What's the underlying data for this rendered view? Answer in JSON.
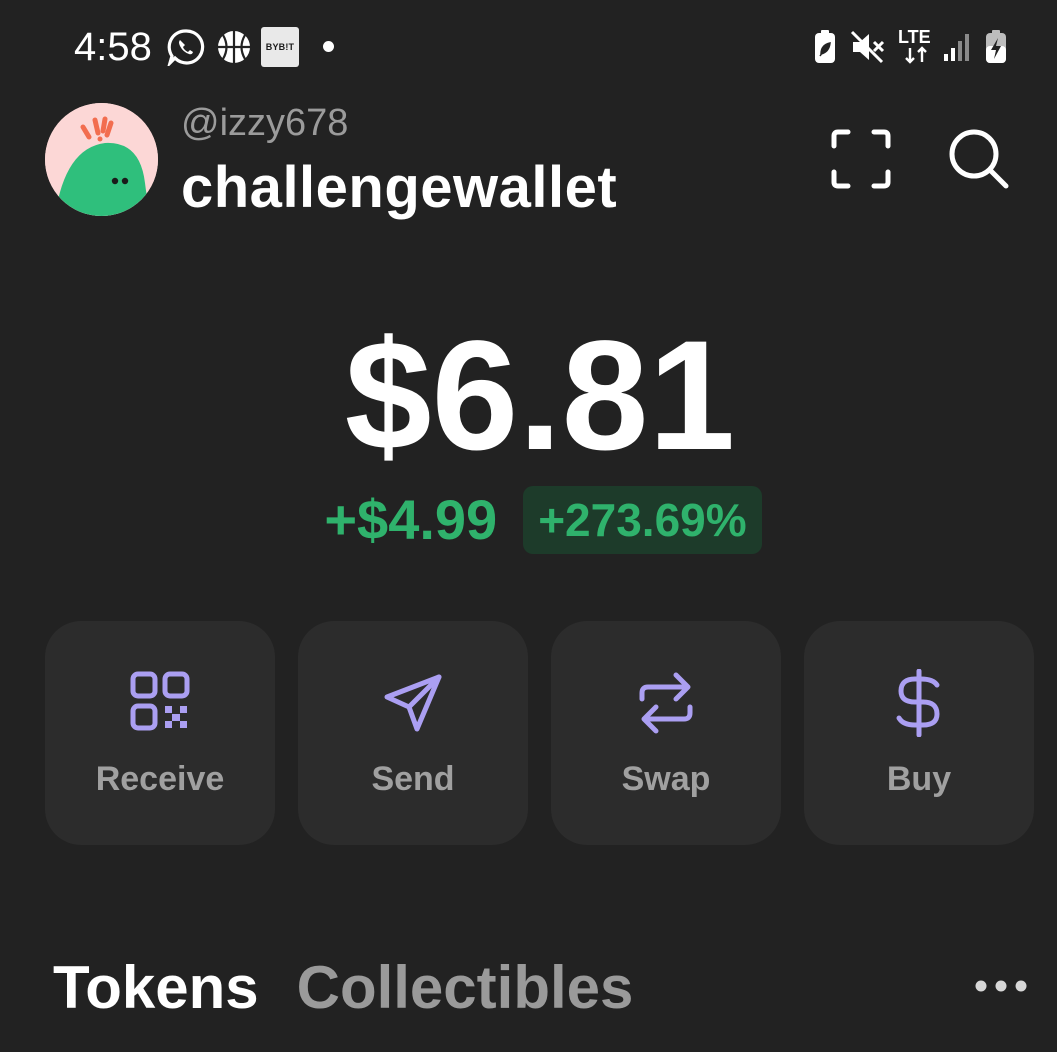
{
  "status_bar": {
    "time": "4:58",
    "notification_icons": [
      "whatsapp-icon",
      "basketball-icon",
      "bybit-icon"
    ],
    "bybit_label": "BYB!T",
    "system_icons": [
      "battery-saver-icon",
      "mute-icon",
      "lte-icon",
      "signal-icon",
      "battery-charging-icon"
    ],
    "network_label": "LTE"
  },
  "header": {
    "handle": "@izzy678",
    "wallet_name": "challengewallet",
    "buttons": [
      "scan-icon",
      "search-icon"
    ]
  },
  "balance": {
    "total": "$6.81",
    "change_amount": "+$4.99",
    "change_percent": "+273.69%"
  },
  "actions": [
    {
      "label": "Receive",
      "icon": "qr-code-icon"
    },
    {
      "label": "Send",
      "icon": "send-icon"
    },
    {
      "label": "Swap",
      "icon": "swap-icon"
    },
    {
      "label": "Buy",
      "icon": "dollar-icon"
    }
  ],
  "tabs": [
    {
      "label": "Tokens",
      "active": true
    },
    {
      "label": "Collectibles",
      "active": false
    }
  ],
  "more_icon": "more-horizontal-icon",
  "colors": {
    "background": "#222222",
    "card": "#2c2c2c",
    "accent_purple": "#ab9ff2",
    "positive_green": "#2fb26c",
    "positive_bg": "#1d3b2a",
    "muted_text": "#9b9b9b"
  }
}
